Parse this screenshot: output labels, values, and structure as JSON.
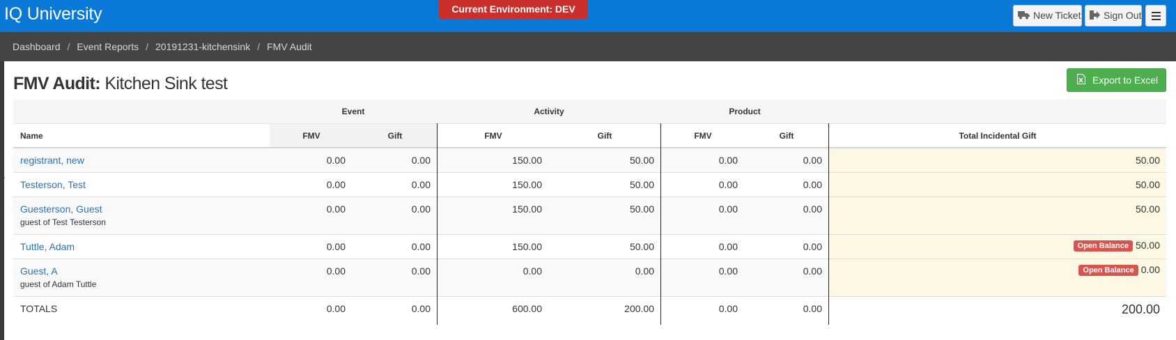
{
  "app": {
    "title": "IQ University",
    "environment": "Current Environment: DEV"
  },
  "nav": {
    "new_ticket": "New Ticket",
    "sign_out": "Sign Out",
    "icons": [
      "truck-icon",
      "sign-out-icon",
      "hamburger-menu-icon"
    ]
  },
  "breadcrumb": [
    "Dashboard",
    "Event Reports",
    "20191231-kitchensink",
    "FMV Audit"
  ],
  "page": {
    "title_bold": "FMV Audit:",
    "title_rest": "Kitchen Sink test",
    "export_label": "Export to Excel",
    "export_icon": "excel-file-icon"
  },
  "table": {
    "groups": {
      "event": "Event",
      "activity": "Activity",
      "product": "Product"
    },
    "columns": {
      "name": "Name",
      "fmv": "FMV",
      "gift": "Gift",
      "total": "Total Incidental Gift"
    },
    "rows": [
      {
        "name": "registrant, new",
        "sub": "",
        "ev_fmv": "0.00",
        "ev_gift": "0.00",
        "ac_fmv": "150.00",
        "ac_gift": "50.00",
        "pr_fmv": "0.00",
        "pr_gift": "0.00",
        "badge": "",
        "total": "50.00"
      },
      {
        "name": "Testerson, Test",
        "sub": "",
        "ev_fmv": "0.00",
        "ev_gift": "0.00",
        "ac_fmv": "150.00",
        "ac_gift": "50.00",
        "pr_fmv": "0.00",
        "pr_gift": "0.00",
        "badge": "",
        "total": "50.00"
      },
      {
        "name": "Guesterson, Guest",
        "sub": "guest of Test Testerson",
        "ev_fmv": "0.00",
        "ev_gift": "0.00",
        "ac_fmv": "150.00",
        "ac_gift": "50.00",
        "pr_fmv": "0.00",
        "pr_gift": "0.00",
        "badge": "",
        "total": "50.00"
      },
      {
        "name": "Tuttle, Adam",
        "sub": "",
        "ev_fmv": "0.00",
        "ev_gift": "0.00",
        "ac_fmv": "150.00",
        "ac_gift": "50.00",
        "pr_fmv": "0.00",
        "pr_gift": "0.00",
        "badge": "Open Balance",
        "total": "50.00"
      },
      {
        "name": "Guest, A",
        "sub": "guest of Adam Tuttle",
        "ev_fmv": "0.00",
        "ev_gift": "0.00",
        "ac_fmv": "0.00",
        "ac_gift": "0.00",
        "pr_fmv": "0.00",
        "pr_gift": "0.00",
        "badge": "Open Balance",
        "total": "0.00"
      }
    ],
    "totals": {
      "label": "TOTALS",
      "ev_fmv": "0.00",
      "ev_gift": "0.00",
      "ac_fmv": "600.00",
      "ac_gift": "200.00",
      "pr_fmv": "0.00",
      "pr_gift": "0.00",
      "total": "200.00"
    }
  },
  "colors": {
    "navbar": "#0a78d6",
    "environment": "#c9302c",
    "breadcrumb_bar": "#444444",
    "export_button": "#4cae4c",
    "total_column": "#fcf8e3",
    "link": "#2a72b5",
    "badge": "#d9534f"
  }
}
